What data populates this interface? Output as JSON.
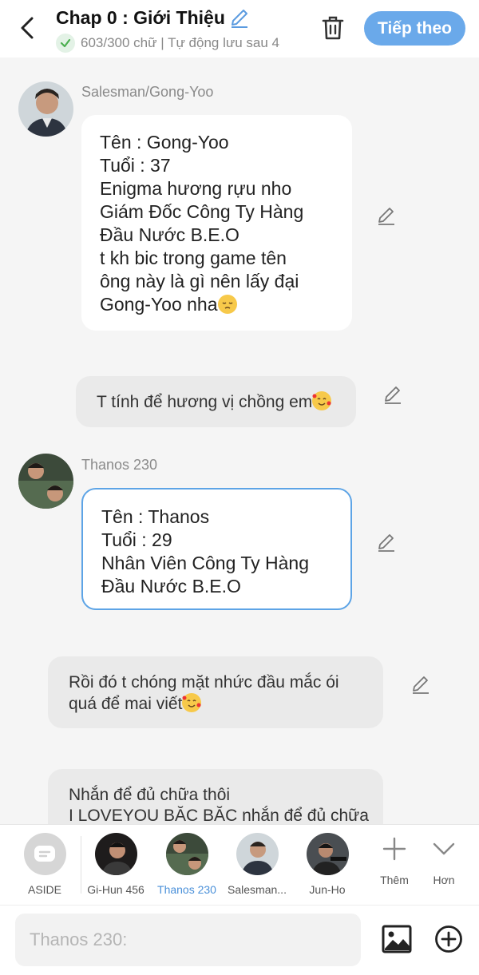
{
  "header": {
    "title": "Chap 0 : Giới Thiệu",
    "status": "603/300 chữ | Tự động lưu sau 4",
    "next_label": "Tiếp theo"
  },
  "messages": [
    {
      "speaker": "Salesman/Gong-Yoo",
      "lines": [
        "Tên : Gong-Yoo",
        "Tuổi : 37",
        "Enigma hương rựu nho",
        "Giám Đốc Công Ty Hàng",
        "Đầu Nước B.E.O",
        " t kh bic trong game tên",
        "ông này là gì nên lấy đại",
        "Gong-Yoo nha"
      ],
      "emoji": "pensive-face-emoji"
    },
    {
      "speaker": "",
      "lines": [
        "T tính để hương vị chồng em"
      ],
      "emoji": "smiling-face-with-hearts-emoji"
    },
    {
      "speaker": "Thanos 230",
      "lines": [
        "Tên : Thanos",
        "Tuổi : 29",
        "Nhân Viên Công Ty Hàng",
        "Đầu Nước B.E.O"
      ],
      "emoji": ""
    },
    {
      "speaker": "",
      "lines": [
        "Rồi đó t chóng mặt nhức đầu mắc ói",
        "quá để mai viết"
      ],
      "emoji": "smiling-face-with-hearts-emoji"
    },
    {
      "speaker": "",
      "lines": [
        "Nhắn để đủ chữa thôi",
        "I LOVEYOU BĂC BĂC nhắn để đủ chữa"
      ],
      "emoji": ""
    }
  ],
  "characters": [
    {
      "label": "ASIDE",
      "active": false
    },
    {
      "label": "Gi-Hun 456",
      "active": false
    },
    {
      "label": "Thanos 230",
      "active": true
    },
    {
      "label": "Salesman...",
      "active": false
    },
    {
      "label": "Jun-Ho",
      "active": false
    }
  ],
  "tools": {
    "add_label": "Thêm",
    "more_label": "Hơn"
  },
  "composer": {
    "placeholder": "Thanos 230:"
  },
  "colors": {
    "accent": "#6aa9ea",
    "active_label": "#4a90d9",
    "selected_border": "#5da4e6",
    "status_check": "#4caf50"
  }
}
